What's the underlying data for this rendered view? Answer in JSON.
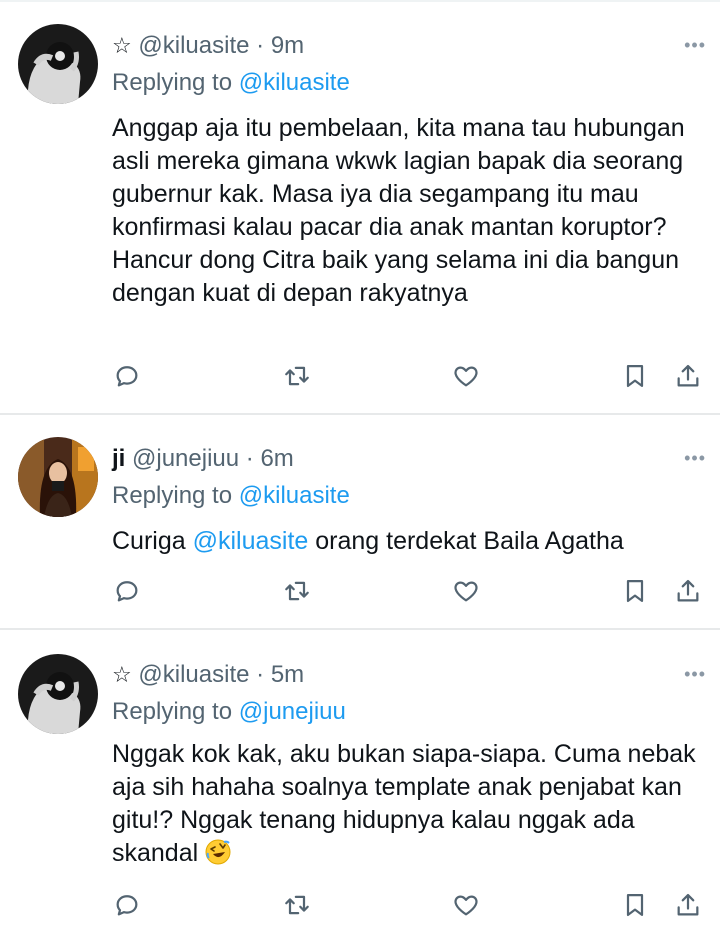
{
  "tweets": [
    {
      "star": "☆",
      "name": "",
      "handle": "@kiluasite",
      "separator": " · ",
      "time": "9m",
      "more": "•••",
      "replying_label": "Replying to",
      "replying_to": "@kiluasite",
      "body": "Anggap aja itu pembelaan, kita mana tau hubungan asli mereka gimana wkwk lagian bapak dia seorang gubernur kak. Masa iya dia segampang itu mau konfirmasi kalau pacar dia anak mantan koruptor? Hancur dong Citra baik yang selama ini dia bangun dengan kuat di depan rakyatnya"
    },
    {
      "name": "ji",
      "handle": "@junejiuu",
      "separator": " · ",
      "time": "6m",
      "more": "•••",
      "replying_label": "Replying to",
      "replying_to": "@kiluasite",
      "body_prefix": "Curiga ",
      "body_mention": "@kiluasite",
      "body_suffix": " orang terdekat Baila Agatha"
    },
    {
      "star": "☆",
      "handle": "@kiluasite",
      "separator": " · ",
      "time": "5m",
      "more": "•••",
      "replying_label": "Replying to",
      "replying_to": "@junejiuu",
      "body": "Nggak kok kak, aku bukan siapa-siapa. Cuma nebak aja sih hahaha soalnya template anak penjabat kan gitu!? Nggak tenang hidupnya kalau nggak ada skandal",
      "emoji": "rolling-on-floor-laughing-emoji"
    }
  ],
  "icons": {
    "reply": "reply-icon",
    "retweet": "retweet-icon",
    "like": "heart-icon",
    "bookmark": "bookmark-icon",
    "share": "share-icon"
  },
  "colors": {
    "text": "#0f1419",
    "secondary": "#536471",
    "mention": "#1d9bf0",
    "divider": "#e7e9ea"
  }
}
